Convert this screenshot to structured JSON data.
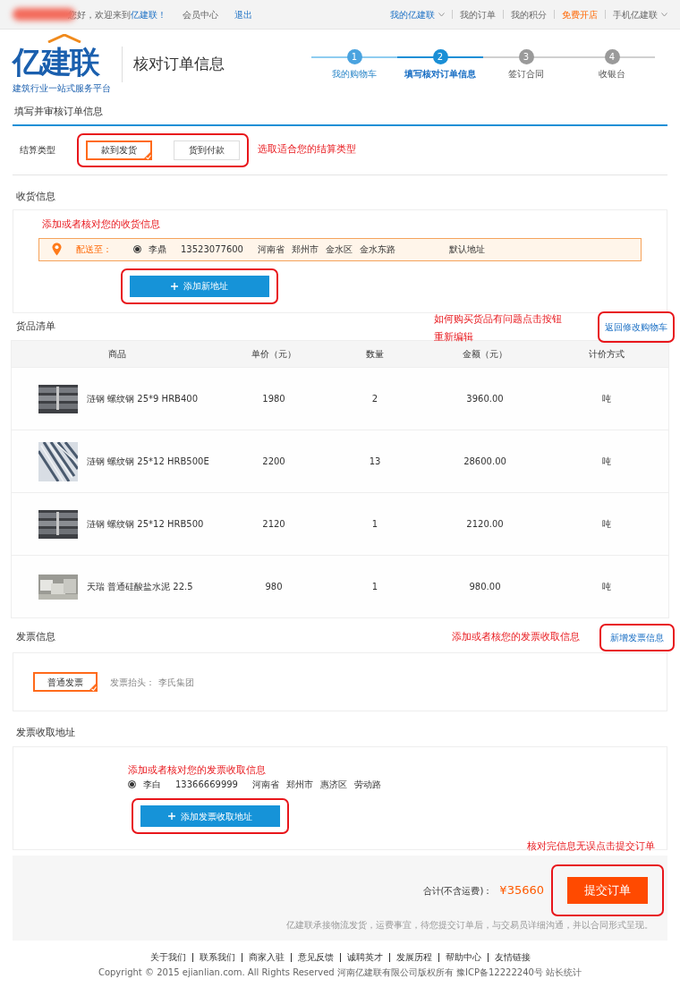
{
  "top_bar": {
    "greeting": "您好，欢迎来到",
    "site_link": "亿建联！",
    "links": [
      "会员中心",
      "退出"
    ],
    "right_links": [
      {
        "label": "我的亿建联",
        "kind": "dropdown"
      },
      {
        "label": "我的订单",
        "kind": "link"
      },
      {
        "label": "我的积分",
        "kind": "link"
      },
      {
        "label": "免费开店",
        "kind": "highlight"
      },
      {
        "label": "手机亿建联",
        "kind": "dropdown"
      }
    ]
  },
  "header": {
    "logo": "亿建联",
    "tagline": "建筑行业一站式服务平台",
    "page_title": "核对订单信息",
    "steps": [
      {
        "number": "1",
        "label": "我的购物车",
        "completed": true,
        "selected": false
      },
      {
        "number": "2",
        "label": "填写核对订单信息",
        "completed": false,
        "selected": true
      },
      {
        "number": "3",
        "label": "签订合同",
        "completed": false,
        "selected": false
      },
      {
        "number": "4",
        "label": "收银台",
        "completed": false,
        "selected": false
      }
    ]
  },
  "form_title": "填写并审核订单信息",
  "settlement": {
    "label": "结算类型",
    "options": [
      {
        "label": "款到发货",
        "selected": true
      },
      {
        "label": "货到付款",
        "selected": false
      }
    ],
    "annotation": "选取适合您的结算类型"
  },
  "shipping": {
    "heading": "收货信息",
    "annotation": "添加或者核对您的收货信息",
    "deliver_to": "配送至：",
    "address": {
      "selected": true,
      "name": "李鼎",
      "phone": "13523077600",
      "parts": [
        "河南省",
        "郑州市",
        "金水区",
        "金水东路"
      ]
    },
    "default_label": "默认地址",
    "add_button": "添加新地址"
  },
  "goods": {
    "heading": "货品清单",
    "annotation": [
      "如何购买货品有问题点击按钮",
      "重新编辑"
    ],
    "back_button": "返回修改购物车",
    "columns": [
      "商品",
      "单价（元）",
      "数量",
      "金额（元）",
      "计价方式"
    ],
    "rows": [
      {
        "kind": "picture",
        "name": "涟钢 螺纹钢 25*9 HRB400",
        "price": "1980",
        "quantity": "2",
        "amount": "3960.00",
        "unit": "吨"
      },
      {
        "kind": "picture",
        "name": "涟钢 螺纹钢 25*12 HRB500E",
        "price": "2200",
        "quantity": "13",
        "amount": "28600.00",
        "unit": "吨"
      },
      {
        "kind": "picture",
        "name": "涟钢 螺纹钢 25*12 HRB500",
        "price": "2120",
        "quantity": "1",
        "amount": "2120.00",
        "unit": "吨"
      },
      {
        "kind": "picture",
        "name": "天瑞 普通硅酸盐水泥 22.5",
        "price": "980",
        "quantity": "1",
        "amount": "980.00",
        "unit": "吨"
      }
    ]
  },
  "invoice": {
    "heading": "发票信息",
    "annotation": "添加或者核您的发票收取信息",
    "add_button": "新增发票信息",
    "type": {
      "label": "普通发票",
      "selected": true
    },
    "title_label": "发票抬头：",
    "title_value": "李氏集团"
  },
  "invoice_address": {
    "heading": "发票收取地址",
    "annotation": "添加或者核对您的发票收取信息",
    "address": {
      "selected": true,
      "name": "李白",
      "phone": "13366669999",
      "parts": [
        "河南省",
        "郑州市",
        "惠济区",
        "劳动路"
      ]
    },
    "add_button": "添加发票收取地址"
  },
  "submit": {
    "annotation": "核对完信息无误点击提交订单",
    "total_label": "合计(不含运费)：",
    "total": "¥35660",
    "button": "提交订单",
    "note": "亿建联承接物流发货，运费事宜，待您提交订单后，与交易员详细沟通，并以合同形式呈现。"
  },
  "footer": {
    "links": [
      "关于我们",
      "联系我们",
      "商家入驻",
      "意见反馈",
      "诚聘英才",
      "发展历程",
      "帮助中心",
      "友情链接"
    ],
    "copyright": "Copyright © 2015 ejianlian.com. All Rights Reserved 河南亿建联有限公司版权所有 豫ICP备12222240号 站长统计"
  }
}
